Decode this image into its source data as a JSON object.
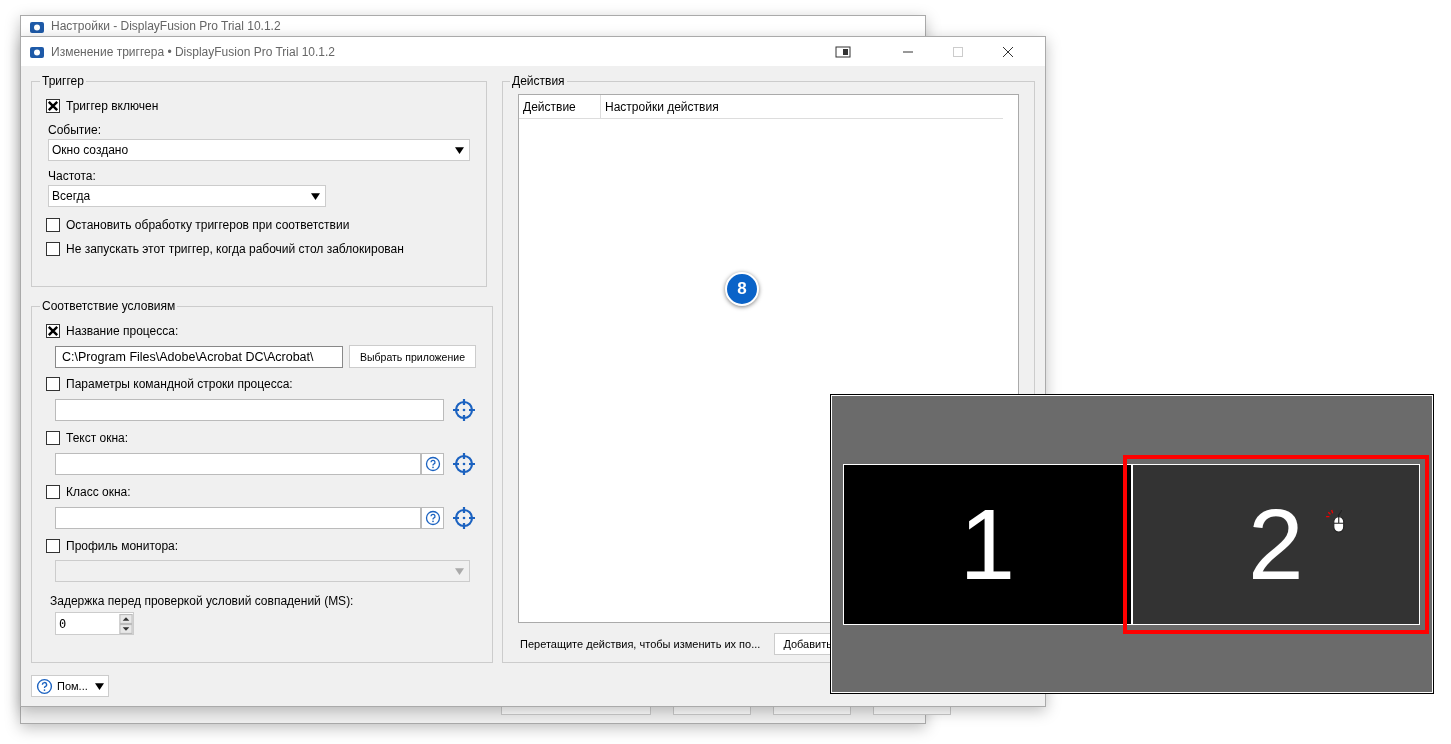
{
  "back_window": {
    "title": "Настройки - DisplayFusion Pro Trial 10.1.2"
  },
  "window": {
    "title": "Изменение триггера • DisplayFusion Pro Trial 10.1.2"
  },
  "trigger": {
    "title": "Триггер",
    "enabled": {
      "label": "Триггер включен",
      "checked": true
    },
    "event": {
      "label": "Событие:",
      "value": "Окно создано"
    },
    "frequency": {
      "label": "Частота:",
      "value": "Всегда"
    },
    "options": [
      {
        "label": "Остановить обработку триггеров при соответствии",
        "checked": false
      },
      {
        "label": "Не запускать этот триггер, когда рабочий стол заблокирован",
        "checked": false
      }
    ]
  },
  "conditions": {
    "title": "Соответствие условиям",
    "items": [
      {
        "kind": "path",
        "label": "Название процесса:",
        "checked": true,
        "value": "C:\\Program Files\\Adobe\\Acrobat DC\\Acrobat\\",
        "button": "Выбрать приложение"
      },
      {
        "kind": "target",
        "label": "Параметры командной строки процесса:",
        "checked": false
      },
      {
        "kind": "help_target",
        "label": "Текст окна:",
        "checked": false
      },
      {
        "kind": "help_target",
        "label": "Класс окна:",
        "checked": false
      },
      {
        "kind": "dropdown",
        "label": "Профиль монитора:",
        "checked": false,
        "disabled": true
      }
    ],
    "delay": {
      "label": "Задержка перед проверкой условий совпадений (MS):",
      "value": "0"
    }
  },
  "actions": {
    "title": "Действия",
    "columns": [
      "Действие",
      "Настройки действия"
    ],
    "badge": "8",
    "hint": "Перетащите действия, чтобы изменить их по...",
    "add_button": "Добавить"
  },
  "help_button": "Пом...",
  "monitors": [
    {
      "label": "1",
      "selected": false
    },
    {
      "label": "2",
      "selected": true
    }
  ]
}
